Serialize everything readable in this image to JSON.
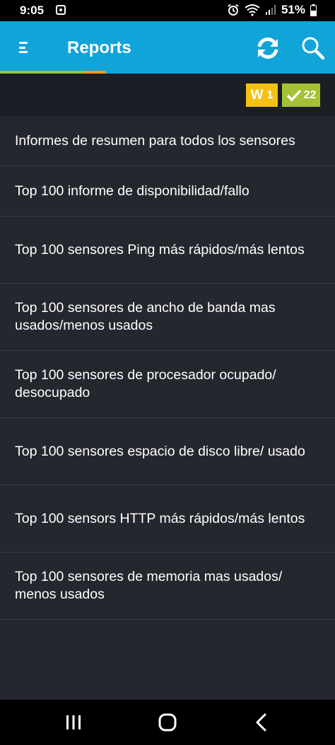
{
  "status_bar": {
    "time": "9:05",
    "battery_percent": "51%",
    "icons": [
      "notification-icon",
      "alarm-icon",
      "wifi-icon",
      "signal-icon",
      "battery-icon"
    ]
  },
  "app_bar": {
    "title": "Reports",
    "background_color": "#11a4d8",
    "icons": [
      "menu-icon",
      "refresh-icon",
      "search-icon"
    ]
  },
  "badges": {
    "warning": {
      "letter": "W",
      "count": "1",
      "color": "#f2c214"
    },
    "ok": {
      "count": "22",
      "color": "#a3c235"
    }
  },
  "reports": [
    {
      "label": "Informes de resumen para todos los sensores"
    },
    {
      "label": "Top 100 informe de disponibilidad/fallo"
    },
    {
      "label": "Top 100 sensores Ping más rápidos/más lentos"
    },
    {
      "label": "Top 100 sensores de ancho de banda mas usados/menos usados"
    },
    {
      "label": "Top 100 sensores de procesador ocupado/ desocupado"
    },
    {
      "label": "Top 100 sensores espacio de disco libre/ usado"
    },
    {
      "label": "Top 100 sensors HTTP más rápidos/más lentos"
    },
    {
      "label": "Top 100 sensores de memoria mas usados/ menos usados"
    }
  ],
  "nav_bar": {
    "icons": [
      "recent-apps-icon",
      "home-icon",
      "back-icon"
    ]
  }
}
